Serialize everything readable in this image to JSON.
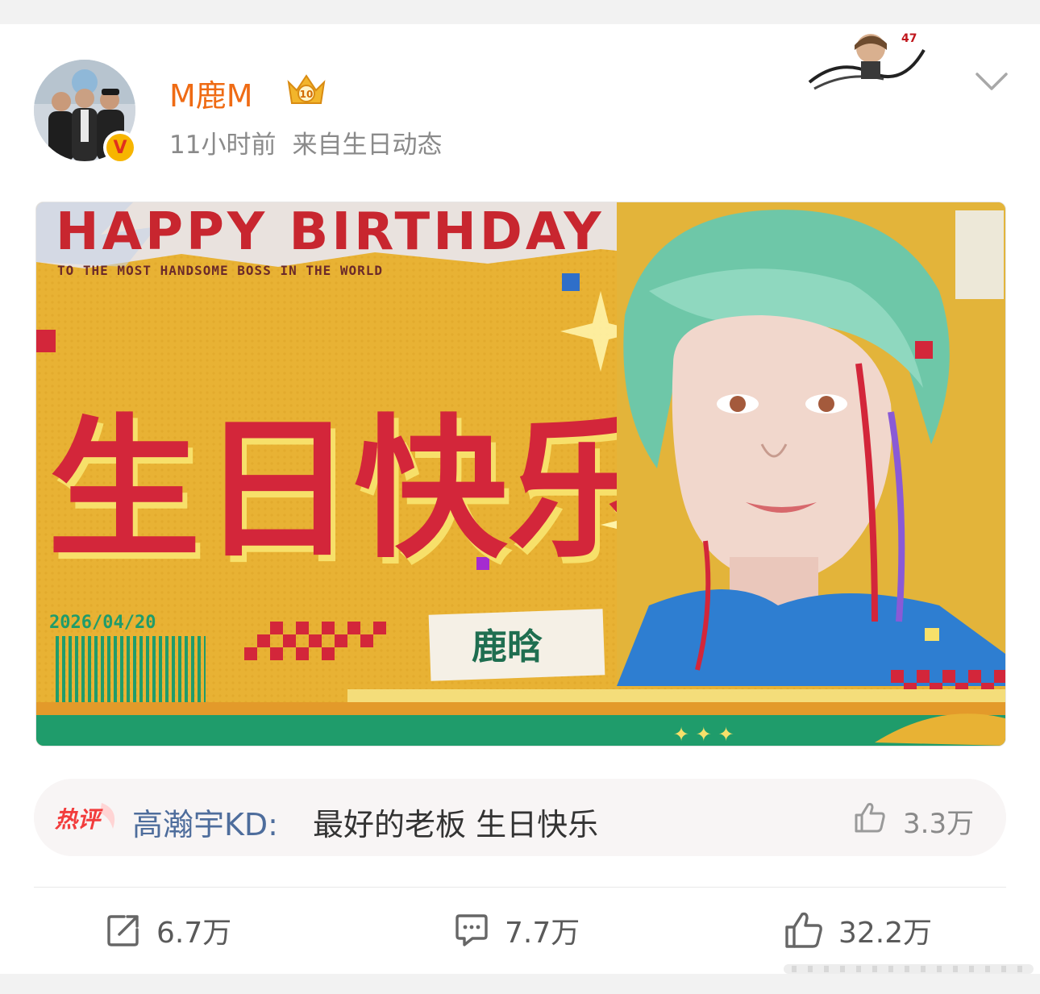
{
  "post": {
    "username": "M鹿M",
    "time": "11小时前",
    "source": "来自生日动态"
  },
  "banner": {
    "headline": "HAPPY BIRTHDAY",
    "subline": "TO THE MOST HANDSOME BOSS IN THE WORLD",
    "title_cn": "生日快乐",
    "date": "2026/04/20",
    "name_tag": "鹿晗"
  },
  "hot_comment": {
    "label": "热评",
    "user": "高瀚宇KD:",
    "text": "最好的老板 生日快乐",
    "likes": "3.3万"
  },
  "actions": {
    "repost": "6.7万",
    "comment": "7.7万",
    "like": "32.2万"
  },
  "colors": {
    "username": "#ef6b14",
    "comment_user": "#4e6d9c",
    "banner_red": "#d3263a",
    "banner_yellow": "#e8b234",
    "banner_green": "#1f9c6b"
  }
}
